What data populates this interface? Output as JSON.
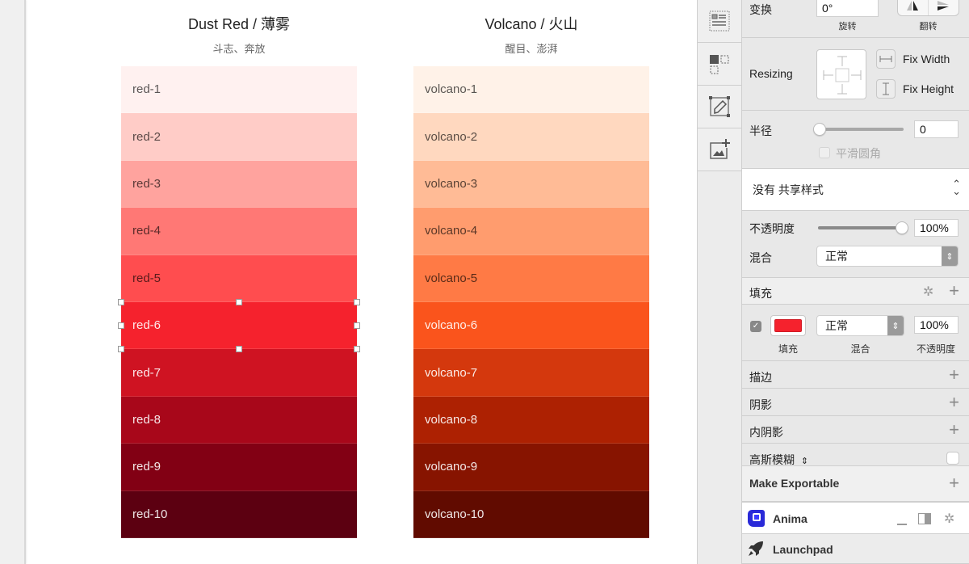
{
  "canvas": {
    "palettes": [
      {
        "id": "red",
        "title": "Dust Red / 薄雾",
        "subtitle": "斗志、奔放",
        "swatches": [
          {
            "label": "red-1",
            "color": "#fff1f0",
            "text": "dark"
          },
          {
            "label": "red-2",
            "color": "#ffccc7",
            "text": "dark"
          },
          {
            "label": "red-3",
            "color": "#ffa39e",
            "text": "dark"
          },
          {
            "label": "red-4",
            "color": "#ff7875",
            "text": "dark"
          },
          {
            "label": "red-5",
            "color": "#ff4d4f",
            "text": "dark"
          },
          {
            "label": "red-6",
            "color": "#f5222d",
            "text": "light",
            "selected": true
          },
          {
            "label": "red-7",
            "color": "#cf1322",
            "text": "light"
          },
          {
            "label": "red-8",
            "color": "#a8071a",
            "text": "light"
          },
          {
            "label": "red-9",
            "color": "#820014",
            "text": "light"
          },
          {
            "label": "red-10",
            "color": "#5c0011",
            "text": "light"
          }
        ]
      },
      {
        "id": "volcano",
        "title": "Volcano / 火山",
        "subtitle": "醒目、澎湃",
        "swatches": [
          {
            "label": "volcano-1",
            "color": "#fff2e8",
            "text": "dark"
          },
          {
            "label": "volcano-2",
            "color": "#ffd8bf",
            "text": "dark"
          },
          {
            "label": "volcano-3",
            "color": "#ffbb96",
            "text": "dark"
          },
          {
            "label": "volcano-4",
            "color": "#ff9c6e",
            "text": "dark"
          },
          {
            "label": "volcano-5",
            "color": "#ff7a45",
            "text": "dark"
          },
          {
            "label": "volcano-6",
            "color": "#fa541c",
            "text": "light"
          },
          {
            "label": "volcano-7",
            "color": "#d4380d",
            "text": "light"
          },
          {
            "label": "volcano-8",
            "color": "#ad2102",
            "text": "light"
          },
          {
            "label": "volcano-9",
            "color": "#871400",
            "text": "light"
          },
          {
            "label": "volcano-10",
            "color": "#610b00",
            "text": "light"
          }
        ]
      }
    ]
  },
  "inspector_tabs": [
    {
      "icon": "inspector-layout-icon"
    },
    {
      "icon": "symbol-overrides-icon"
    },
    {
      "icon": "edit-shape-icon"
    },
    {
      "icon": "add-image-icon"
    }
  ],
  "inspector": {
    "transform": {
      "label": "变换",
      "rotation_value": "0°",
      "rotation_label": "旋转",
      "flip_label": "翻转"
    },
    "resizing": {
      "label": "Resizing",
      "fix_width": "Fix Width",
      "fix_height": "Fix Height"
    },
    "radius": {
      "label": "半径",
      "value": "0",
      "slider_fraction": 0,
      "smooth_corners_label": "平滑圆角"
    },
    "shared_style": {
      "value": "没有 共享样式"
    },
    "opacity": {
      "label": "不透明度",
      "value": "100%",
      "slider_fraction": 1
    },
    "blend": {
      "label": "混合",
      "value": "正常"
    },
    "fill": {
      "header": "填充",
      "color": "#f5222d",
      "blend_value": "正常",
      "opacity_value": "100%",
      "fill_label": "填充",
      "blend_label": "混合",
      "opacity_label": "不透明度",
      "enabled": true
    },
    "border": {
      "label": "描边"
    },
    "shadow": {
      "label": "阴影"
    },
    "inner_shadow": {
      "label": "内阴影"
    },
    "blur": {
      "label": "高斯模糊",
      "enabled": false
    },
    "export": {
      "label": "Make Exportable"
    },
    "plugins": [
      {
        "name": "Anima",
        "icon": "anima-logo-icon"
      },
      {
        "name": "Launchpad",
        "icon": "rocket-icon"
      }
    ]
  }
}
